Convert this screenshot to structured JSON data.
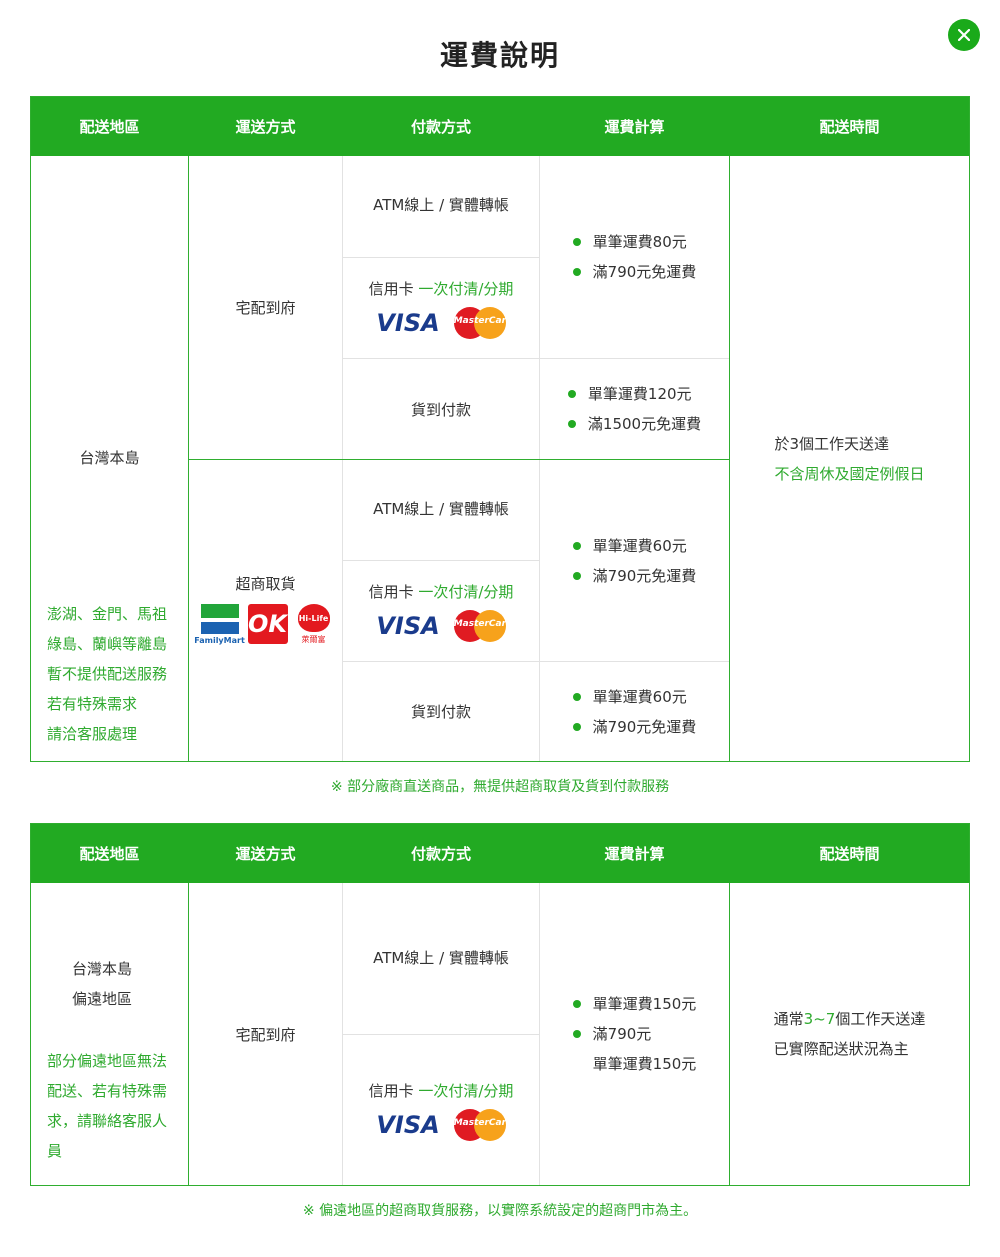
{
  "modal": {
    "title": "運費說明",
    "close_icon": "close-icon"
  },
  "headers": [
    "配送地區",
    "運送方式",
    "付款方式",
    "運費計算",
    "配送時間"
  ],
  "table1": {
    "region": "台灣本島",
    "region_note": [
      "澎湖、金門、馬祖",
      "綠島、蘭嶼等離島",
      "暫不提供配送服務",
      "若有特殊需求",
      "請洽客服處理"
    ],
    "home": {
      "method": "宅配到府",
      "atm": "ATM線上 / 實體轉帳",
      "card_prefix": "信用卡",
      "card_highlight": "一次付清/分期",
      "visa": "VISA",
      "mastercard": "MasterCard",
      "prepaid_fee": [
        "單筆運費80元",
        "滿790元免運費"
      ],
      "cod": "貨到付款",
      "cod_fee": [
        "單筆運費120元",
        "滿1500元免運費"
      ]
    },
    "store": {
      "method": "超商取貨",
      "familymart": "FamilyMart",
      "ok": "OK",
      "hilife": "Hi-Life",
      "hilife_sub": "萊爾富",
      "atm": "ATM線上 / 實體轉帳",
      "card_prefix": "信用卡",
      "card_highlight": "一次付清/分期",
      "visa": "VISA",
      "mastercard": "MasterCard",
      "prepaid_fee": [
        "單筆運費60元",
        "滿790元免運費"
      ],
      "cod": "貨到付款",
      "cod_fee": [
        "單筆運費60元",
        "滿790元免運費"
      ]
    },
    "time": "於3個工作天送達",
    "time_note": "不含周休及國定例假日",
    "footnote": "※ 部分廠商直送商品，無提供超商取貨及貨到付款服務"
  },
  "table2": {
    "region_lines": [
      "台灣本島",
      "偏遠地區"
    ],
    "region_note": [
      "部分偏遠地區無法",
      "配送、若有特殊需",
      "求，請聯絡客服人",
      "員"
    ],
    "method": "宅配到府",
    "atm": "ATM線上 / 實體轉帳",
    "card_prefix": "信用卡",
    "card_highlight": "一次付清/分期",
    "visa": "VISA",
    "mastercard": "MasterCard",
    "fee": [
      "單筆運費150元",
      "滿790元",
      "單筆運費150元"
    ],
    "time_pre": "通常",
    "time_highlight": "3~7",
    "time_post": "個工作天送達",
    "time_note": "已實際配送狀況為主",
    "footnote": "※ 偏遠地區的超商取貨服務，以實際系統設定的超商門市為主。"
  },
  "colors": {
    "brand_green": "#22aa22",
    "text_green": "#2faa2f",
    "visa_blue": "#1a3b8c",
    "mc_red": "#e01b22",
    "mc_yellow": "#f7a21b"
  }
}
